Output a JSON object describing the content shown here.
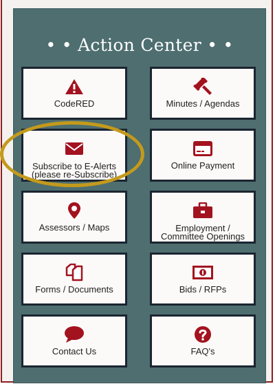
{
  "title": "• • Action Center • •",
  "colors": {
    "icon": "#a3121f",
    "panel": "#4e6e70",
    "highlight": "#c49a1c",
    "frame": "#8a1f1f"
  },
  "tiles": [
    {
      "label": "CodeRED",
      "icon": "warning-triangle-icon"
    },
    {
      "label": "Minutes / Agendas",
      "icon": "gavel-icon"
    },
    {
      "label": "Subscribe to E-Alerts (please re-Subscribe)",
      "label1": "Subscribe to E-Alerts",
      "label2": "(please re-Subscribe)",
      "icon": "envelope-icon"
    },
    {
      "label": "Online Payment",
      "icon": "credit-card-icon"
    },
    {
      "label": "Assessors / Maps",
      "icon": "map-marker-icon"
    },
    {
      "label": "Employment / Committee Openings",
      "label1": "Employment /",
      "label2": "Committee Openings",
      "icon": "briefcase-icon"
    },
    {
      "label": "Forms / Documents",
      "icon": "documents-icon"
    },
    {
      "label": "Bids / RFPs",
      "icon": "money-bill-icon"
    },
    {
      "label": "Contact Us",
      "icon": "speech-bubble-icon"
    },
    {
      "label": "FAQ's",
      "icon": "question-circle-icon"
    }
  ]
}
